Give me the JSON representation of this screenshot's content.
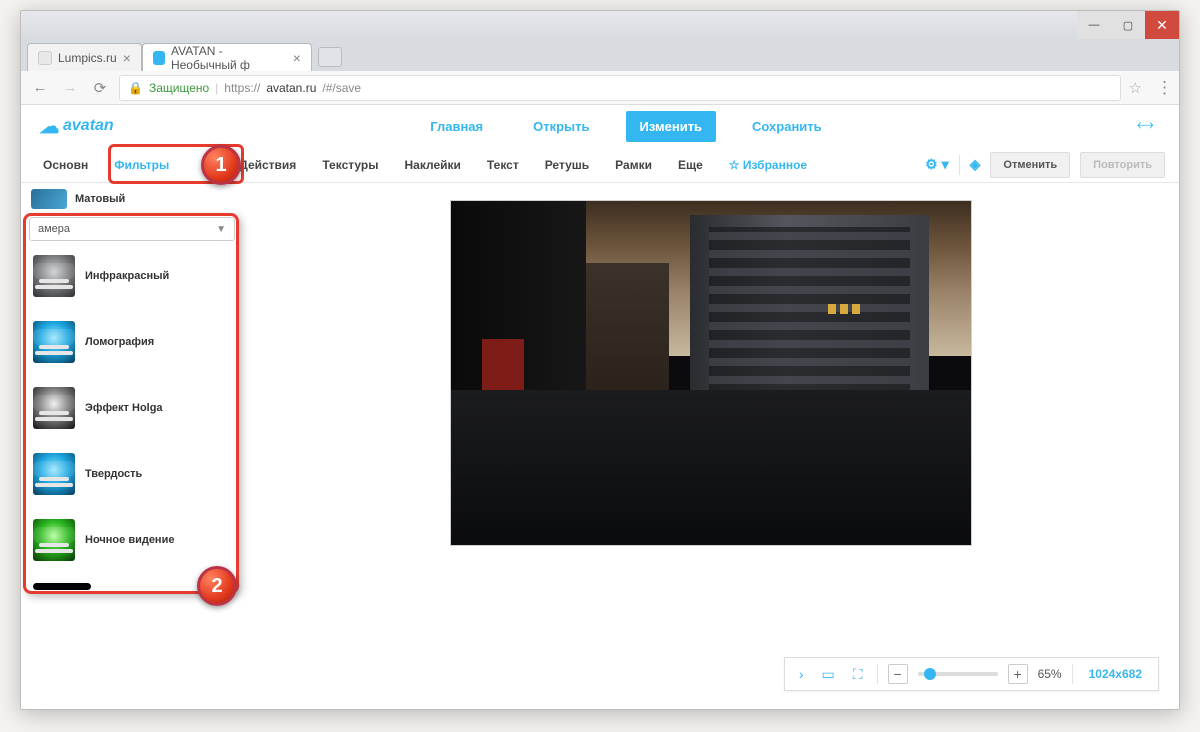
{
  "window": {
    "tabs": [
      {
        "title": "Lumpics.ru"
      },
      {
        "title": "AVATAN - Необычный ф"
      }
    ]
  },
  "address": {
    "secure_label": "Защищено",
    "proto": "https://",
    "domain": "avatan.ru",
    "path": "/#/save"
  },
  "logo": {
    "text": "avatan"
  },
  "header_nav": {
    "home": "Главная",
    "open": "Открыть",
    "edit": "Изменить",
    "save": "Сохранить"
  },
  "toolbar": {
    "basic": "Основн",
    "filters": "Фильтры",
    "actions": "Действия",
    "textures": "Текстуры",
    "stickers": "Наклейки",
    "text": "Текст",
    "retouch": "Ретушь",
    "frames": "Рамки",
    "more": "Еще",
    "fav": "Избранное",
    "undo": "Отменить",
    "redo": "Повторить"
  },
  "sidebar": {
    "top_item": "Матовый",
    "category": "амера",
    "filters": [
      {
        "label": "Инфракрасный",
        "tone": "gray"
      },
      {
        "label": "Ломография",
        "tone": "blue"
      },
      {
        "label": "Эффект Holga",
        "tone": "bw"
      },
      {
        "label": "Твердость",
        "tone": "blue"
      },
      {
        "label": "Ночное видение",
        "tone": "green"
      }
    ]
  },
  "callouts": {
    "one": "1",
    "two": "2"
  },
  "canvas_bar": {
    "zoom_pct": "65%",
    "dims": "1024x682"
  }
}
